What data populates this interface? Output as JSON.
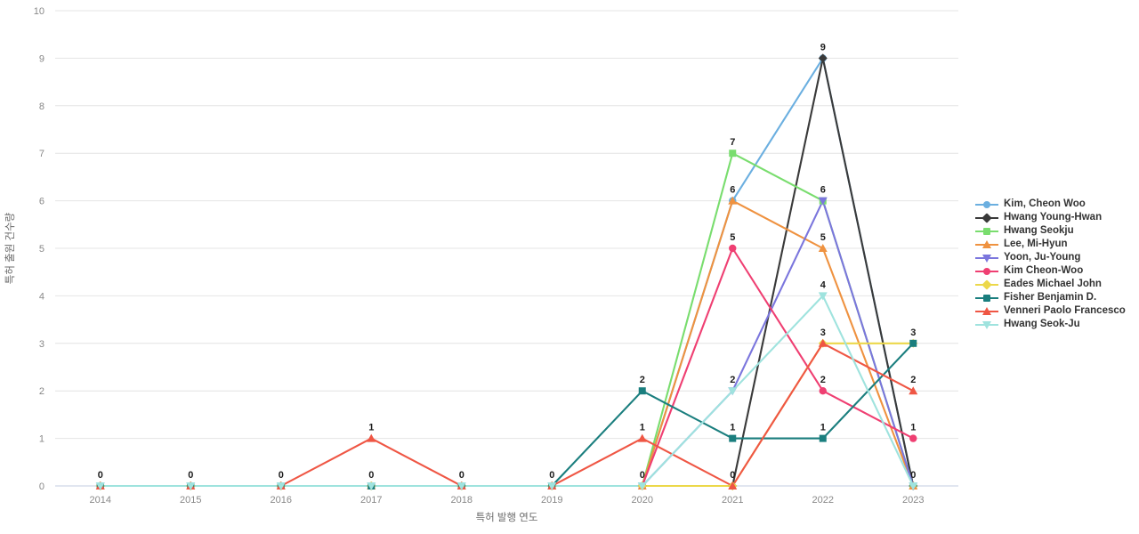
{
  "chart_data": {
    "type": "line",
    "title": "",
    "xlabel": "특허 발행 연도",
    "ylabel": "특허 출원 건수량",
    "categories": [
      "2014",
      "2015",
      "2016",
      "2017",
      "2018",
      "2019",
      "2020",
      "2021",
      "2022",
      "2023"
    ],
    "x": [
      2014,
      2015,
      2016,
      2017,
      2018,
      2019,
      2020,
      2021,
      2022,
      2023
    ],
    "ylim": [
      0,
      10
    ],
    "yticks": [
      0,
      1,
      2,
      3,
      4,
      5,
      6,
      7,
      8,
      9,
      10
    ],
    "grid": true,
    "legend_position": "right",
    "data_labels": true,
    "series": [
      {
        "name": "Kim, Cheon Woo",
        "color": "#6bafe0",
        "marker": "circle",
        "values": [
          0,
          0,
          0,
          0,
          0,
          0,
          0,
          6,
          9,
          0
        ]
      },
      {
        "name": "Hwang Young-Hwan",
        "color": "#3a3a3a",
        "marker": "diamond",
        "values": [
          0,
          0,
          0,
          0,
          0,
          0,
          0,
          0,
          9,
          0
        ]
      },
      {
        "name": "Hwang Seokju",
        "color": "#79dd6e",
        "marker": "square",
        "values": [
          0,
          0,
          0,
          0,
          0,
          0,
          0,
          7,
          6,
          0
        ]
      },
      {
        "name": "Lee, Mi-Hyun",
        "color": "#ef9240",
        "marker": "triangle",
        "values": [
          0,
          0,
          0,
          0,
          0,
          0,
          0,
          6,
          5,
          0
        ]
      },
      {
        "name": "Yoon, Ju-Young",
        "color": "#7b76dd",
        "marker": "itriangle",
        "values": [
          0,
          0,
          0,
          0,
          0,
          0,
          0,
          2,
          6,
          0
        ]
      },
      {
        "name": "Kim Cheon-Woo",
        "color": "#ef3f72",
        "marker": "circle",
        "values": [
          0,
          0,
          0,
          0,
          0,
          0,
          0,
          5,
          2,
          1
        ]
      },
      {
        "name": "Eades Michael John",
        "color": "#ecd84a",
        "marker": "diamond",
        "values": [
          0,
          0,
          0,
          0,
          0,
          0,
          0,
          0,
          3,
          3
        ]
      },
      {
        "name": "Fisher Benjamin D.",
        "color": "#1a7e7e",
        "marker": "square",
        "values": [
          0,
          0,
          0,
          0,
          0,
          0,
          2,
          1,
          1,
          3
        ]
      },
      {
        "name": "Venneri Paolo Francesco",
        "color": "#ef5644",
        "marker": "triangle",
        "values": [
          0,
          0,
          0,
          1,
          0,
          0,
          1,
          0,
          3,
          2
        ]
      },
      {
        "name": "Hwang Seok-Ju",
        "color": "#9fe3de",
        "marker": "itriangle",
        "values": [
          0,
          0,
          0,
          0,
          0,
          0,
          0,
          2,
          4,
          0
        ]
      }
    ],
    "visible_point_labels": [
      {
        "year": "2014",
        "value": "0"
      },
      {
        "year": "2015",
        "value": "0"
      },
      {
        "year": "2016",
        "value": "0"
      },
      {
        "year": "2017",
        "value": "1"
      },
      {
        "year": "2017",
        "value": "0"
      },
      {
        "year": "2018",
        "value": "0"
      },
      {
        "year": "2019",
        "value": "0"
      },
      {
        "year": "2020",
        "value": "2"
      },
      {
        "year": "2020",
        "value": "1"
      },
      {
        "year": "2020",
        "value": "0"
      },
      {
        "year": "2021",
        "value": "7"
      },
      {
        "year": "2021",
        "value": "6"
      },
      {
        "year": "2021",
        "value": "5"
      },
      {
        "year": "2021",
        "value": "2"
      },
      {
        "year": "2021",
        "value": "1"
      },
      {
        "year": "2021",
        "value": "0"
      },
      {
        "year": "2022",
        "value": "9"
      },
      {
        "year": "2022",
        "value": "6"
      },
      {
        "year": "2022",
        "value": "5"
      },
      {
        "year": "2022",
        "value": "4"
      },
      {
        "year": "2022",
        "value": "3"
      },
      {
        "year": "2022",
        "value": "2"
      },
      {
        "year": "2022",
        "value": "1"
      },
      {
        "year": "2023",
        "value": "3"
      },
      {
        "year": "2023",
        "value": "2"
      },
      {
        "year": "2023",
        "value": "1"
      },
      {
        "year": "2023",
        "value": "0"
      }
    ]
  },
  "axes": {
    "ylabel": "특허 출원 건수량",
    "xlabel": "특허 발행 연도"
  },
  "legend": {
    "items": [
      {
        "label": "Kim, Cheon Woo"
      },
      {
        "label": "Hwang Young-Hwan"
      },
      {
        "label": "Hwang Seokju"
      },
      {
        "label": "Lee, Mi-Hyun"
      },
      {
        "label": "Yoon, Ju-Young"
      },
      {
        "label": "Kim Cheon-Woo"
      },
      {
        "label": "Eades Michael John"
      },
      {
        "label": "Fisher Benjamin D."
      },
      {
        "label": "Venneri Paolo Francesco"
      },
      {
        "label": "Hwang Seok-Ju"
      }
    ]
  }
}
